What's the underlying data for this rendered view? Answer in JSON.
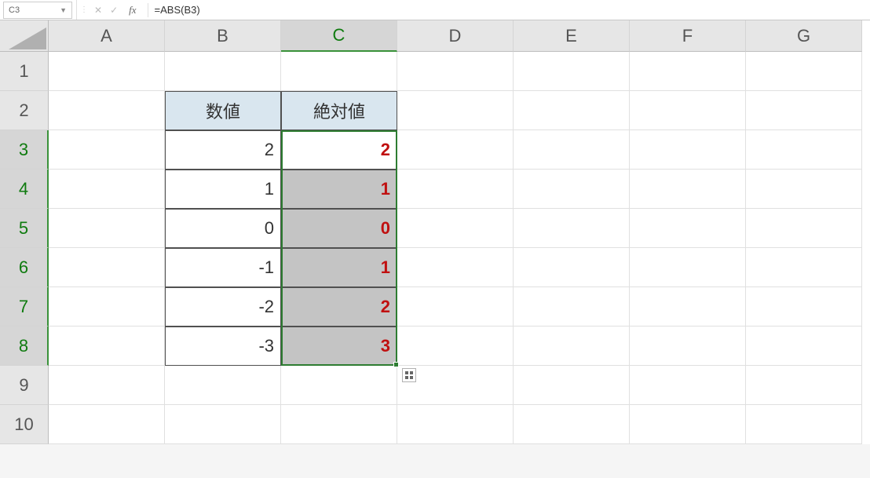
{
  "nameBox": "C3",
  "formula": "=ABS(B3)",
  "colHeaders": [
    "A",
    "B",
    "C",
    "D",
    "E",
    "F",
    "G"
  ],
  "rowHeaders": [
    "1",
    "2",
    "3",
    "4",
    "5",
    "6",
    "7",
    "8",
    "9",
    "10"
  ],
  "table": {
    "hB": "数値",
    "hC": "絶対値",
    "rows": [
      {
        "b": "2",
        "c": "2"
      },
      {
        "b": "1",
        "c": "1"
      },
      {
        "b": "0",
        "c": "0"
      },
      {
        "b": "-1",
        "c": "1"
      },
      {
        "b": "-2",
        "c": "2"
      },
      {
        "b": "-3",
        "c": "3"
      }
    ]
  },
  "fx": "fx",
  "cancel": "✕",
  "enter": "✓"
}
